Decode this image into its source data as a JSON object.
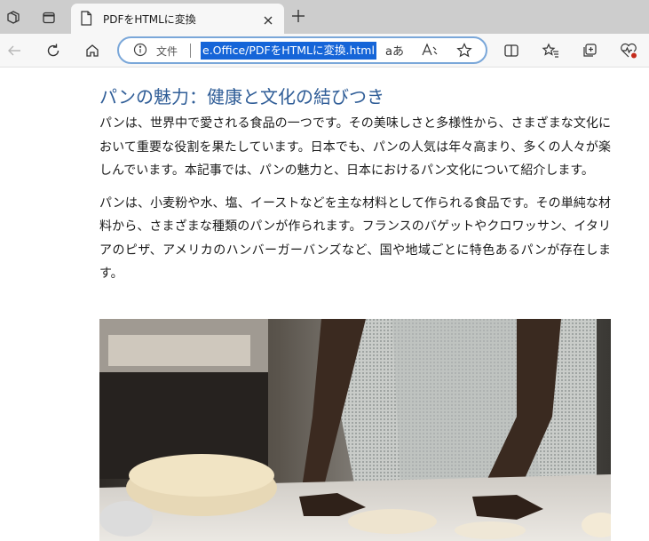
{
  "browser": {
    "tab": {
      "title": "PDFをHTMLに変換",
      "close_glyph": "✕"
    },
    "new_tab_glyph": "+",
    "address": {
      "info_label": "文件",
      "url_visible": "e.Office/PDFをHTMLに変換.html",
      "read_aloud_glyph": "aあ"
    },
    "icons": [
      "workspaces-icon",
      "tab-actions-icon",
      "back-icon",
      "reload-icon",
      "home-icon",
      "info-icon",
      "read-aloud-icon",
      "text-size-icon",
      "favorite-icon",
      "split-screen-icon",
      "favorites-icon",
      "collections-icon",
      "health-icon"
    ]
  },
  "article": {
    "title": "パンの魅力：健康と文化の結びつき",
    "paragraphs": [
      "パンは、世界中で愛される食品の一つです。その美味しさと多様性から、さまざまな文化において重要な役割を果たしています。日本でも、パンの人気は年々高まり、多くの人々が楽しんでいます。本記事では、パンの魅力と、日本におけるパン文化について紹介します。",
      "パンは、小麦粉や水、塩、イーストなどを主な材料として作られる食品です。その単純な材料から、さまざまな種類のパンが作られます。フランスのバゲットやクロワッサン、イタリアのピザ、アメリカのハンバーガーバンズなど、国や地域ごとに特色あるパンが存在します。"
    ],
    "image_subject": "baker-kneading-dough-photo"
  },
  "colors": {
    "tabstrip": "#cdcdcd",
    "toolbar": "#f7f7f7",
    "omnibox_border": "#7aa7d9",
    "url_selection": "#1565d8",
    "title": "#2f5d97"
  }
}
